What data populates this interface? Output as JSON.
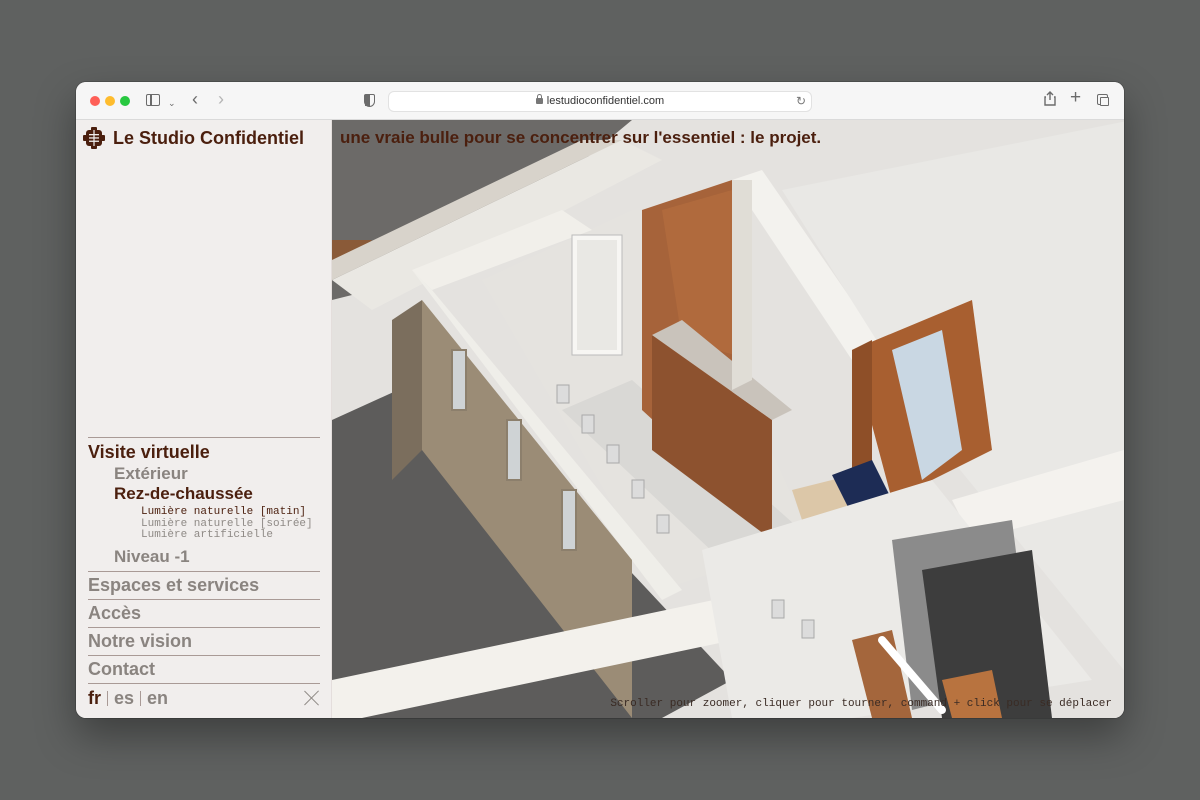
{
  "browser": {
    "url": "lestudioconfidentiel.com"
  },
  "site": {
    "brand": "Le Studio Confidentiel",
    "tagline": "une vraie bulle pour se concentrer sur l'essentiel : le projet."
  },
  "nav": {
    "visite": "Visite virtuelle",
    "exterieur": "Extérieur",
    "rdc": "Rez-de-chaussée",
    "lights": [
      "Lumière naturelle [matin]",
      "Lumière naturelle [soirée]",
      "Lumière artificielle"
    ],
    "niveau": "Niveau -1",
    "items": [
      "Espaces et services",
      "Accès",
      "Notre vision",
      "Contact"
    ]
  },
  "lang": {
    "fr": "fr",
    "es": "es",
    "en": "en"
  },
  "viewer": {
    "hint": "Scroller pour zoomer, cliquer pour tourner, command + click pour se déplacer"
  },
  "colors": {
    "brand": "#4b1f0e",
    "muted": "#8a8480",
    "sidebar_bg": "#f1eeed"
  }
}
